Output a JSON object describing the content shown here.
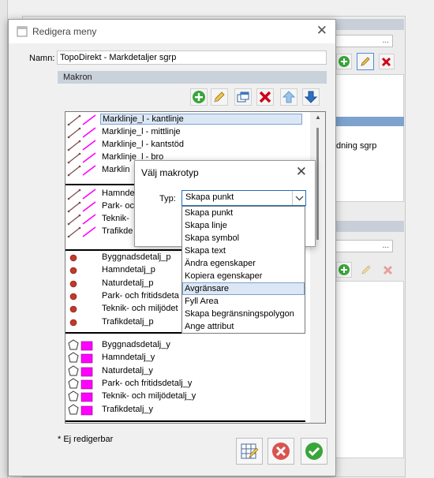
{
  "background_window": {
    "browse_label_1": "...",
    "browse_label_2": "...",
    "partial_text": "dning sgrp"
  },
  "dialog": {
    "title": "Redigera meny",
    "name_label": "Namn:",
    "name_value": "TopoDirekt - Markdetaljer sgrp",
    "section_title": "Makron",
    "footnote": "* Ej redigerbar",
    "items_lines": [
      "Marklinje_l - kantlinje",
      "Marklinje_l - mittlinje",
      "Marklinje_l - kantstöd",
      "Marklinje_l - bro",
      "Marklin"
    ],
    "items_lines2": [
      "Hamndet",
      "Park- och",
      "Teknik-",
      "Trafikde"
    ],
    "items_points": [
      "Byggnadsdetalj_p",
      "Hamndetalj_p",
      "Naturdetalj_p",
      "Park- och fritidsdeta",
      "Teknik- och miljödet",
      "Trafikdetalj_p"
    ],
    "items_areas": [
      "Byggnadsdetalj_y",
      "Hamndetalj_y",
      "Naturdetalj_y",
      "Park- och fritidsdetalj_y",
      "Teknik- och miljödetalj_y",
      "Trafikdetalj_y"
    ]
  },
  "popup": {
    "title": "Välj makrotyp",
    "type_label": "Typ:",
    "selected_value": "Skapa punkt",
    "options": [
      "Skapa punkt",
      "Skapa linje",
      "Skapa symbol",
      "Skapa text",
      "Ändra egenskaper",
      "Kopiera egenskaper",
      "Avgränsare",
      "Fyll Area",
      "Skapa begränsningspolygon",
      "Ange attribut"
    ],
    "highlighted_index": 6
  },
  "icons": [
    "add-icon",
    "edit-icon",
    "copy-icon",
    "delete-icon",
    "move-up-icon",
    "move-down-icon",
    "line-macro-icon",
    "point-macro-icon",
    "area-macro-icon",
    "grid-icon",
    "cancel-icon",
    "ok-icon",
    "close-icon",
    "chevron-down-icon"
  ],
  "colors": {
    "accent_blue": "#1f6fbf",
    "selection_bg": "#dce7f5",
    "section_header_bg": "#c9d1db",
    "magenta": "#ff00ff",
    "point_red": "#c0392b",
    "ok_green": "#3aa53a",
    "cancel_red": "#d9534f"
  }
}
